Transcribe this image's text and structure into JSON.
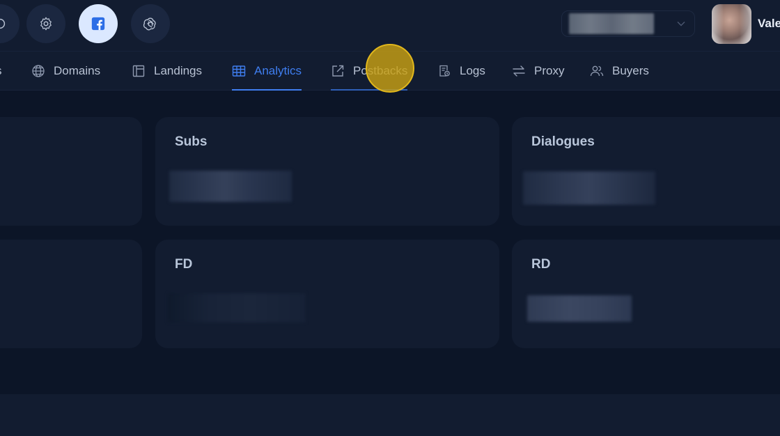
{
  "topbar": {
    "buttons": [
      {
        "name": "partial-icon",
        "active": false
      },
      {
        "name": "gear-icon",
        "active": false
      },
      {
        "name": "facebook-icon",
        "active": true
      },
      {
        "name": "openai-icon",
        "active": false
      }
    ],
    "account_select": {
      "value": "",
      "icon": "chevron-down-icon"
    },
    "user": {
      "name": "Vale"
    }
  },
  "nav": {
    "items": [
      {
        "label": "s",
        "icon": ""
      },
      {
        "label": "Domains",
        "icon": "globe-icon"
      },
      {
        "label": "Landings",
        "icon": "layout-icon"
      },
      {
        "label": "Analytics",
        "icon": "table-icon",
        "active": true
      },
      {
        "label": "Postbacks",
        "icon": "external-link-icon"
      },
      {
        "label": "Logs",
        "icon": "log-document-icon"
      },
      {
        "label": "Proxy",
        "icon": "swap-arrows-icon"
      },
      {
        "label": "Buyers",
        "icon": "users-icon"
      }
    ]
  },
  "cards": [
    {
      "title": ""
    },
    {
      "title": "Subs"
    },
    {
      "title": "Dialogues"
    },
    {
      "title": ""
    },
    {
      "title": "FD"
    },
    {
      "title": "RD"
    }
  ],
  "colors": {
    "background": "#121c30",
    "panel_bg": "#0c1527",
    "card_bg": "#121c30",
    "accent": "#3f7ef0",
    "click_highlight": "#e2b81c"
  }
}
